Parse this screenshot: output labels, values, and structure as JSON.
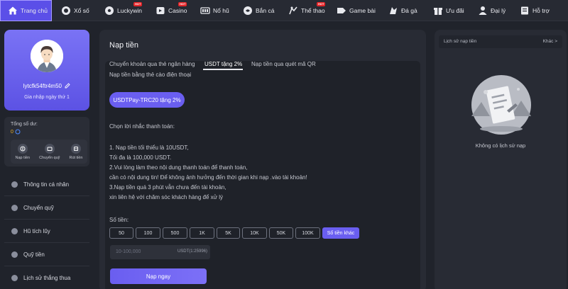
{
  "nav": [
    {
      "label": "Trang chủ",
      "icon": "home-icon",
      "active": true,
      "hot": false
    },
    {
      "label": "Xổ số",
      "icon": "lottery-icon",
      "hot": false
    },
    {
      "label": "Luckywin",
      "icon": "soccer-ball-icon",
      "hot": true
    },
    {
      "label": "Casino",
      "icon": "casino-icon",
      "hot": true
    },
    {
      "label": "Nổ hũ",
      "icon": "slot-machine-icon",
      "hot": false
    },
    {
      "label": "Bắn cá",
      "icon": "fish-icon",
      "hot": false
    },
    {
      "label": "Thể thao",
      "icon": "sports-icon",
      "hot": true
    },
    {
      "label": "Game bài",
      "icon": "cards-icon",
      "hot": false
    },
    {
      "label": "Đá gà",
      "icon": "rooster-icon",
      "hot": false
    },
    {
      "label": "Ưu đãi",
      "icon": "gift-icon",
      "hot": false
    },
    {
      "label": "Đại lý",
      "icon": "agent-icon",
      "hot": false
    },
    {
      "label": "Hỗ trợ",
      "icon": "support-icon",
      "hot": false
    }
  ],
  "hot_badge": "HOT",
  "profile": {
    "username": "lytcfk54ftr4m50",
    "level": "Gia nhập ngày thứ 1"
  },
  "wallet": {
    "label": "Tổng số dư:",
    "balance": "0",
    "actions": [
      {
        "label": "Nạp tiền",
        "icon": "deposit-icon"
      },
      {
        "label": "Chuyển quỹ",
        "icon": "wallet-icon"
      },
      {
        "label": "Rút tiền",
        "icon": "withdraw-icon"
      }
    ]
  },
  "menu": [
    {
      "label": "Thông tin cá nhân",
      "icon": "user-icon"
    },
    {
      "label": "Chuyển quỹ",
      "icon": "wallet-icon"
    },
    {
      "label": "Hũ tích lũy",
      "icon": "jar-icon"
    },
    {
      "label": "Quỹ tiền",
      "icon": "fund-icon"
    },
    {
      "label": "Lịch sử thắng thua",
      "icon": "history-icon"
    }
  ],
  "deposit": {
    "title": "Nạp tiền",
    "tabs": [
      {
        "label": "Chuyển khoản qua thẻ ngân hàng",
        "active": false
      },
      {
        "label": "USDT tặng 2%",
        "active": true
      },
      {
        "label": "Nạp tiền qua quét mã QR",
        "active": false
      },
      {
        "label": "Nạp tiền bằng thẻ cào điện thoại",
        "active": false
      }
    ],
    "method_chip": "USDTPay-TRC20 tặng 2%",
    "prompt": "Chọn lời nhắc thanh toán:",
    "notes": [
      "1. Nạp tiền tối thiểu là 10USDT,",
      "Tối đa là 100,000 USDT.",
      "2.Vui lòng làm theo nội dung thanh toán để thanh toán,",
      "cần có nội dung tin! Để không ảnh hưởng đến thời gian khi nạp .vào tài khoản!",
      "3.Nạp tiền quá 3 phút vẫn chưa đến tài khoản,",
      "xin liên hệ với chăm sóc khách hàng để xử lý"
    ],
    "amount_label": "Số tiền:",
    "amounts": [
      "50",
      "100",
      "500",
      "1K",
      "5K",
      "10K",
      "50K",
      "100K"
    ],
    "other_amount": "Số tiền khác",
    "input_placeholder": "10-100,000",
    "unit": "USDT(1:25996)",
    "submit": "Nạp ngay"
  },
  "history": {
    "title": "Lịch sử nạp tiền",
    "more": "Khác >",
    "empty": "Không có lịch sử nạp"
  },
  "colors": {
    "accent": "#6a5ef0",
    "balance": "#f0b429",
    "hot": "#e5262a"
  }
}
